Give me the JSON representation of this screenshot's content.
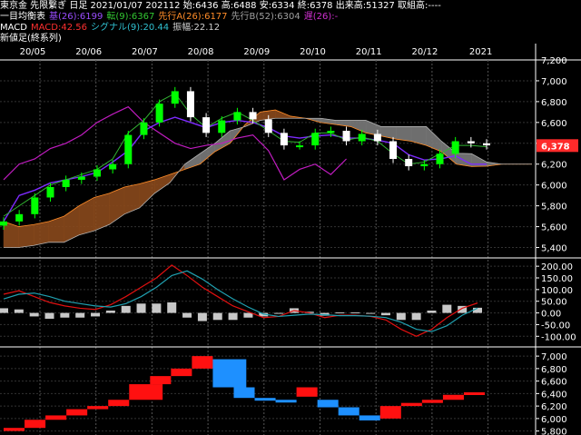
{
  "header": {
    "line1": "東京金 先限繋ぎ 日足 2021/01/07 202112 始:6436 高:6488 安:6334 終:6378 出来高:51327 取組高:----",
    "ichimoku_title": "一目均衡表",
    "ichimoku_kijun": "基(26):6199",
    "ichimoku_tenkan": "転(9):6367",
    "ichimoku_senkou_a": "先行A(26):6177",
    "ichimoku_senkou_b": "先行B(52):6304",
    "ichimoku_chikou": "遅(26):-",
    "macd_title": "MACD",
    "macd_value": "MACD:42.56",
    "macd_signal": "シグナル(9):20.44",
    "macd_hist": "振幅:22.12",
    "lower_title": "新値足(終系列)"
  },
  "colors": {
    "up_candle": "#00ff00",
    "down_candle": "#ffffff",
    "kijun": "#7e2bff",
    "tenkan": "#32b432",
    "chikou": "#c01cc0",
    "cloud_up": "#8a4a1c",
    "cloud_down": "#7a7a7a",
    "macd_line": "#e01010",
    "signal_line": "#20a0b0",
    "hist": "#c8c8c8",
    "new_price_up": "#ff1010",
    "new_price_down": "#1e90ff",
    "price_tag_bg": "#ff2a2a",
    "axis_text": "#ffffff"
  },
  "chart_data": [
    {
      "type": "candlestick",
      "title": "東京金 先限繋ぎ 日足",
      "x_labels": [
        "20/05",
        "20/06",
        "20/07",
        "20/08",
        "20/09",
        "20/10",
        "20/11",
        "20/12",
        "2021"
      ],
      "y_ticks": [
        "7,000",
        "6,800",
        "6,600",
        "6,400",
        "6,200",
        "6,000",
        "5,800",
        "5,600",
        "5,400"
      ],
      "y_top_label": "7,200",
      "ylim": [
        5300,
        7200
      ],
      "last_price": "6,378",
      "close": [
        5650,
        5720,
        5880,
        5980,
        6050,
        6080,
        6150,
        6200,
        6480,
        6600,
        6780,
        6900,
        6650,
        6500,
        6620,
        6700,
        6630,
        6500,
        6380,
        6380,
        6500,
        6520,
        6420,
        6490,
        6420,
        6250,
        6180,
        6200,
        6300,
        6420,
        6400,
        6380
      ],
      "kijun": [
        5650,
        5900,
        5950,
        6020,
        6050,
        6080,
        6120,
        6220,
        6330,
        6520,
        6600,
        6650,
        6600,
        6550,
        6600,
        6620,
        6600,
        6550,
        6470,
        6450,
        6470,
        6480,
        6450,
        6450,
        6430,
        6400,
        6290,
        6240,
        6250,
        6280,
        6200,
        6199
      ],
      "tenkan": [
        5700,
        5800,
        5900,
        6000,
        6050,
        6100,
        6150,
        6250,
        6500,
        6620,
        6800,
        6880,
        6680,
        6550,
        6640,
        6700,
        6620,
        6520,
        6420,
        6410,
        6500,
        6500,
        6430,
        6460,
        6420,
        6300,
        6200,
        6220,
        6300,
        6380,
        6380,
        6367
      ],
      "chikou": [
        6050,
        6200,
        6250,
        6350,
        6400,
        6480,
        6600,
        6680,
        6750,
        6600,
        6500,
        6400,
        6350,
        6380,
        6400,
        6450,
        6480,
        6330,
        6050,
        6150,
        6200,
        6100,
        6250
      ],
      "senkou_a": [
        5650,
        5600,
        5620,
        5650,
        5700,
        5800,
        5880,
        5920,
        5980,
        6010,
        6050,
        6100,
        6150,
        6200,
        6320,
        6400,
        6580,
        6700,
        6720,
        6660,
        6640,
        6600,
        6580,
        6560,
        6500,
        6470,
        6440,
        6420,
        6380,
        6320,
        6200,
        6177,
        6180,
        6200,
        6200,
        6200
      ],
      "senkou_b": [
        5400,
        5400,
        5420,
        5450,
        5450,
        5520,
        5560,
        5620,
        5720,
        5780,
        5920,
        6020,
        6200,
        6300,
        6400,
        6520,
        6560,
        6620,
        6640,
        6640,
        6640,
        6640,
        6620,
        6620,
        6620,
        6560,
        6560,
        6560,
        6560,
        6420,
        6304,
        6300,
        6220,
        6200,
        6200,
        6200
      ]
    },
    {
      "type": "line",
      "title": "MACD",
      "y_ticks": [
        "200.00",
        "150.00",
        "100.00",
        "50.00",
        "0.00",
        "-50.00",
        "-100.00"
      ],
      "ylim": [
        -130,
        220
      ],
      "series": [
        {
          "name": "MACD",
          "values": [
            80,
            95,
            70,
            45,
            30,
            20,
            15,
            35,
            70,
            110,
            150,
            205,
            160,
            110,
            70,
            30,
            5,
            -20,
            -15,
            10,
            0,
            -20,
            -10,
            -10,
            -15,
            -30,
            -70,
            -100,
            -70,
            -20,
            20,
            42.56
          ]
        },
        {
          "name": "シグナル",
          "values": [
            60,
            80,
            85,
            70,
            50,
            40,
            30,
            25,
            40,
            70,
            110,
            160,
            180,
            145,
            100,
            60,
            25,
            -5,
            -15,
            -10,
            -5,
            -8,
            -12,
            -12,
            -14,
            -20,
            -40,
            -70,
            -80,
            -55,
            -10,
            20.44
          ]
        }
      ],
      "hist": [
        20,
        15,
        -15,
        -25,
        -20,
        -20,
        -15,
        10,
        30,
        40,
        40,
        45,
        -20,
        -35,
        -30,
        -30,
        -20,
        -15,
        0,
        20,
        5,
        -12,
        2,
        2,
        -1,
        -10,
        -30,
        -30,
        10,
        35,
        30,
        22.12
      ]
    },
    {
      "type": "step",
      "title": "新値足(終系列)",
      "y_ticks": [
        "7,000",
        "6,800",
        "6,600",
        "6,400",
        "6,200",
        "6,000",
        "5,800"
      ],
      "ylim": [
        5780,
        7060
      ],
      "steps": [
        {
          "from": 5800,
          "to": 5850,
          "dir": "up"
        },
        {
          "from": 5850,
          "to": 5980,
          "dir": "up"
        },
        {
          "from": 5980,
          "to": 6050,
          "dir": "up"
        },
        {
          "from": 6050,
          "to": 6150,
          "dir": "up"
        },
        {
          "from": 6150,
          "to": 6200,
          "dir": "up"
        },
        {
          "from": 6200,
          "to": 6300,
          "dir": "up"
        },
        {
          "from": 6300,
          "to": 6550,
          "dir": "up"
        },
        {
          "from": 6550,
          "to": 6680,
          "dir": "up"
        },
        {
          "from": 6680,
          "to": 6800,
          "dir": "up"
        },
        {
          "from": 6800,
          "to": 7000,
          "dir": "up"
        },
        {
          "from": 6950,
          "to": 6500,
          "dir": "down"
        },
        {
          "from": 6500,
          "to": 6330,
          "dir": "down"
        },
        {
          "from": 6330,
          "to": 6300,
          "dir": "down"
        },
        {
          "from": 6300,
          "to": 6290,
          "dir": "down"
        },
        {
          "from": 6350,
          "to": 6500,
          "dir": "up"
        },
        {
          "from": 6300,
          "to": 6180,
          "dir": "down"
        },
        {
          "from": 6180,
          "to": 6050,
          "dir": "down"
        },
        {
          "from": 6050,
          "to": 5970,
          "dir": "down"
        },
        {
          "from": 6000,
          "to": 6200,
          "dir": "up"
        },
        {
          "from": 6200,
          "to": 6250,
          "dir": "up"
        },
        {
          "from": 6250,
          "to": 6300,
          "dir": "up"
        },
        {
          "from": 6300,
          "to": 6380,
          "dir": "up"
        },
        {
          "from": 6380,
          "to": 6420,
          "dir": "up"
        }
      ]
    }
  ]
}
